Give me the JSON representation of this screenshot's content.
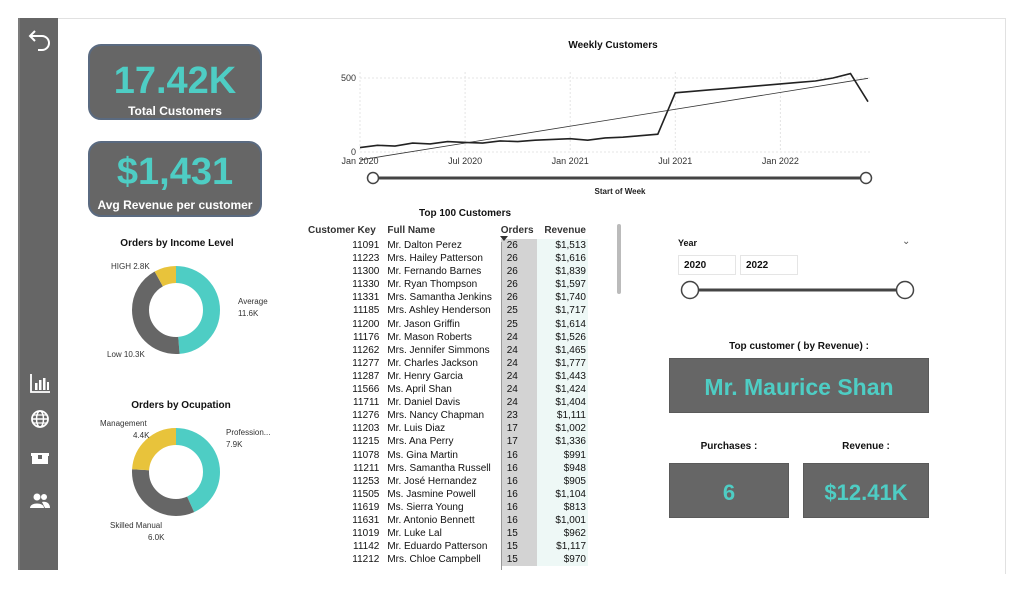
{
  "nav": {
    "icons": [
      "back-arrow-icon",
      "bar-chart-icon",
      "globe-icon",
      "package-icon",
      "users-icon"
    ]
  },
  "kpis": {
    "total_customers_value": "17.42K",
    "total_customers_label": "Total Customers",
    "avg_revenue_value": "$1,431",
    "avg_revenue_label": "Avg Revenue per customer"
  },
  "income_chart": {
    "title": "Orders by Income Level",
    "slices": [
      {
        "label": "Average",
        "value": "11.6K",
        "num": 11.6,
        "color": "#4ecdc4"
      },
      {
        "label": "Low",
        "value": "10.3K",
        "num": 10.3,
        "color": "#666666"
      },
      {
        "label": "HIGH",
        "value": "2.8K",
        "num": 2.8,
        "color": "#e8c33b"
      }
    ],
    "label_average": "Average",
    "value_average": "11.6K",
    "label_low": "Low 10.3K",
    "label_high": "HIGH 2.8K"
  },
  "occupation_chart": {
    "title": "Orders by Ocupation",
    "slices": [
      {
        "label": "Profession...",
        "value": "7.9K",
        "num": 7.9,
        "color": "#4ecdc4"
      },
      {
        "label": "Skilled Manual",
        "value": "6.0K",
        "num": 6.0,
        "color": "#666666"
      },
      {
        "label": "Management",
        "value": "4.4K",
        "num": 4.4,
        "color": "#e8c33b"
      }
    ],
    "label_prof": "Profession...",
    "value_prof": "7.9K",
    "label_skilled": "Skilled Manual",
    "value_skilled": "6.0K",
    "label_mgmt": "Management",
    "value_mgmt": "4.4K"
  },
  "chart_data": {
    "type": "line",
    "title": "Weekly Customers",
    "xlabel": "Start of Week",
    "x_ticks": [
      "Jan 2020",
      "Jul 2020",
      "Jan 2021",
      "Jul 2021",
      "Jan 2022"
    ],
    "y_ticks": [
      "0",
      "500"
    ],
    "ylim": [
      0,
      600
    ],
    "trend_line": true,
    "series": [
      {
        "x": [
          "2020-01",
          "2020-02",
          "2020-03",
          "2020-04",
          "2020-05",
          "2020-06",
          "2020-07",
          "2020-08",
          "2020-09",
          "2020-10",
          "2020-11",
          "2020-12",
          "2021-01",
          "2021-02",
          "2021-03",
          "2021-04",
          "2021-05",
          "2021-06",
          "2021-07",
          "2021-08",
          "2021-09",
          "2021-10",
          "2021-11",
          "2021-12",
          "2022-01",
          "2022-02",
          "2022-03",
          "2022-04",
          "2022-05",
          "2022-06"
        ],
        "values": [
          30,
          45,
          40,
          60,
          55,
          70,
          65,
          60,
          75,
          70,
          80,
          85,
          90,
          80,
          95,
          100,
          110,
          120,
          400,
          410,
          420,
          430,
          440,
          450,
          460,
          470,
          480,
          500,
          530,
          340
        ]
      }
    ]
  },
  "table": {
    "title": "Top 100 Customers",
    "headers": [
      "Customer Key",
      "Full Name",
      "Orders",
      "Revenue"
    ],
    "rows": [
      [
        "11091",
        "Mr. Dalton Perez",
        "26",
        "$1,513"
      ],
      [
        "11223",
        "Mrs. Hailey Patterson",
        "26",
        "$1,616"
      ],
      [
        "11300",
        "Mr. Fernando Barnes",
        "26",
        "$1,839"
      ],
      [
        "11330",
        "Mr. Ryan Thompson",
        "26",
        "$1,597"
      ],
      [
        "11331",
        "Mrs. Samantha Jenkins",
        "26",
        "$1,740"
      ],
      [
        "11185",
        "Mrs. Ashley Henderson",
        "25",
        "$1,717"
      ],
      [
        "11200",
        "Mr. Jason Griffin",
        "25",
        "$1,614"
      ],
      [
        "11176",
        "Mr. Mason Roberts",
        "24",
        "$1,526"
      ],
      [
        "11262",
        "Mrs. Jennifer Simmons",
        "24",
        "$1,465"
      ],
      [
        "11277",
        "Mr. Charles Jackson",
        "24",
        "$1,777"
      ],
      [
        "11287",
        "Mr. Henry Garcia",
        "24",
        "$1,443"
      ],
      [
        "11566",
        "Ms. April Shan",
        "24",
        "$1,424"
      ],
      [
        "11711",
        "Mr. Daniel Davis",
        "24",
        "$1,404"
      ],
      [
        "11276",
        "Mrs. Nancy Chapman",
        "23",
        "$1,111"
      ],
      [
        "11203",
        "Mr. Luis Diaz",
        "17",
        "$1,002"
      ],
      [
        "11215",
        "Mrs. Ana Perry",
        "17",
        "$1,336"
      ],
      [
        "11078",
        "Ms. Gina Martin",
        "16",
        "$991"
      ],
      [
        "11211",
        "Mrs. Samantha Russell",
        "16",
        "$948"
      ],
      [
        "11253",
        "Mr. José Hernandez",
        "16",
        "$905"
      ],
      [
        "11505",
        "Ms. Jasmine Powell",
        "16",
        "$1,104"
      ],
      [
        "11619",
        "Ms. Sierra Young",
        "16",
        "$813"
      ],
      [
        "11631",
        "Mr. Antonio Bennett",
        "16",
        "$1,001"
      ],
      [
        "11019",
        "Mr. Luke Lal",
        "15",
        "$962"
      ],
      [
        "11142",
        "Mr. Eduardo Patterson",
        "15",
        "$1,117"
      ],
      [
        "11212",
        "Mrs. Chloe Campbell",
        "15",
        "$970"
      ]
    ]
  },
  "year_slicer": {
    "label": "Year",
    "from": "2020",
    "to": "2022"
  },
  "top_customer": {
    "title": "Top customer ( by Revenue) :",
    "name": "Mr. Maurice Shan",
    "purchases_label": "Purchases :",
    "purchases_value": "6",
    "revenue_label": "Revenue :",
    "revenue_value": "$12.41K"
  },
  "colors": {
    "accent": "#4ecdc4",
    "panel": "#666666",
    "highlight": "#e8c33b"
  }
}
